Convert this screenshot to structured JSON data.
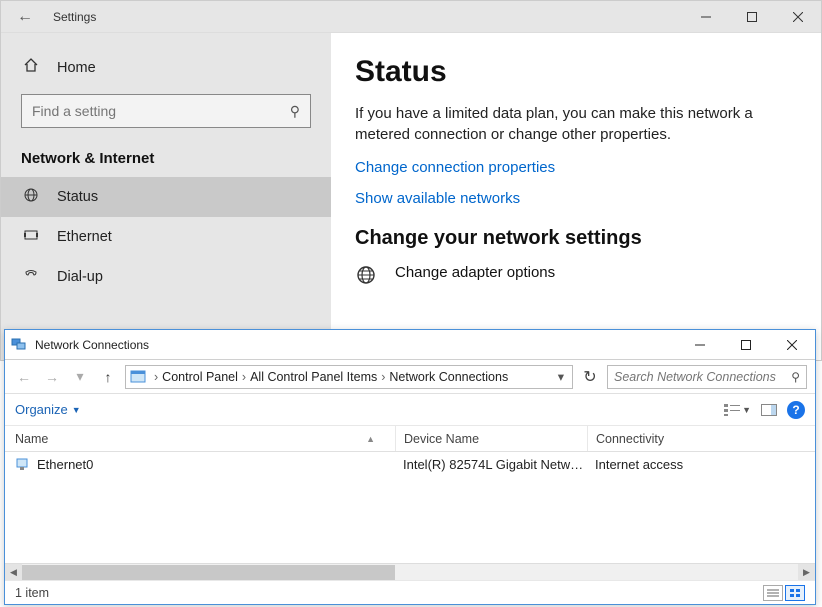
{
  "settings": {
    "titlebar": {
      "title": "Settings"
    },
    "sidebar": {
      "home": "Home",
      "search_placeholder": "Find a setting",
      "section": "Network & Internet",
      "items": [
        {
          "label": "Status",
          "icon": "status-icon"
        },
        {
          "label": "Ethernet",
          "icon": "ethernet-icon"
        },
        {
          "label": "Dial-up",
          "icon": "dialup-icon"
        }
      ]
    },
    "main": {
      "heading": "Status",
      "description": "If you have a limited data plan, you can make this network a metered connection or change other properties.",
      "link1": "Change connection properties",
      "link2": "Show available networks",
      "subheading": "Change your network settings",
      "option1_title": "Change adapter options"
    }
  },
  "explorer": {
    "title": "Network Connections",
    "breadcrumb": {
      "p0": "Control Panel",
      "p1": "All Control Panel Items",
      "p2": "Network Connections"
    },
    "search_placeholder": "Search Network Connections",
    "toolbar": {
      "organize": "Organize"
    },
    "columns": {
      "name": "Name",
      "device": "Device Name",
      "connectivity": "Connectivity"
    },
    "rows": [
      {
        "name": "Ethernet0",
        "device": "Intel(R) 82574L Gigabit Network ...",
        "connectivity": "Internet access"
      }
    ],
    "status": "1 item"
  }
}
